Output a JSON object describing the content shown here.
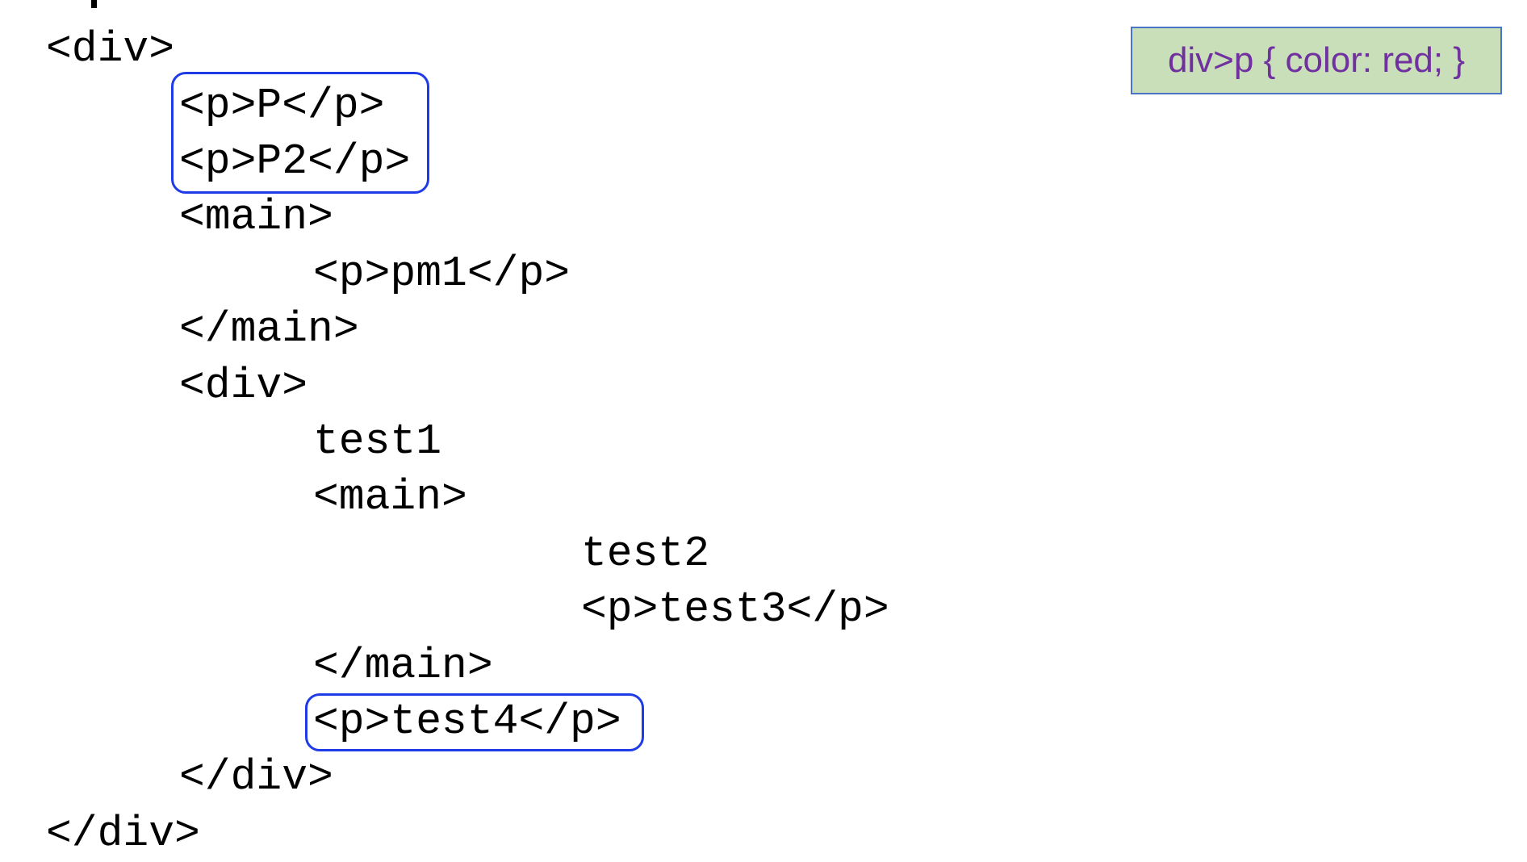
{
  "css_rule": "div>p { color: red; }",
  "code_lines": [
    "<div>",
    "<p>P</p>",
    "<p>P2</p>",
    "<main>",
    "<p>pm1</p>",
    "</main>",
    "<div>",
    "test1",
    "<main>",
    "test2",
    "<p>test3</p>",
    "</main>",
    "<p>test4</p>",
    "</div>",
    "</div>"
  ],
  "colors": {
    "highlight": "#1f3be8",
    "rule_bg": "#c9dfb9",
    "rule_text": "#7030a0"
  }
}
